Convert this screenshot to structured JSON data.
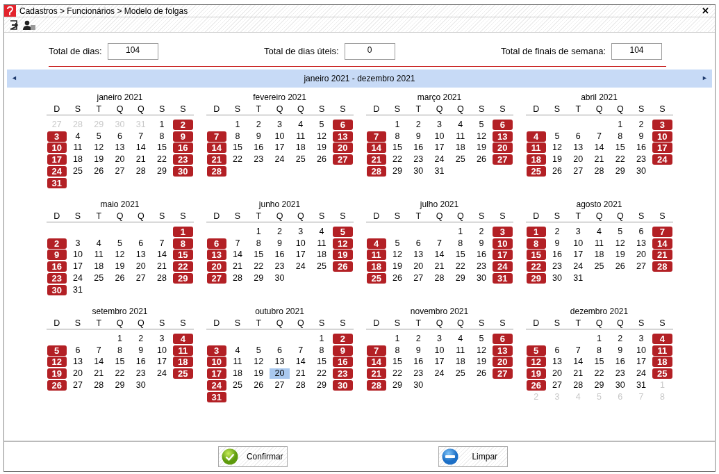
{
  "window": {
    "title": "Cadastros > Funcionários > Modelo de folgas",
    "close": "✕"
  },
  "totals": [
    {
      "label": "Total de dias:",
      "value": "104"
    },
    {
      "label": "Total de dias úteis:",
      "value": "0"
    },
    {
      "label": "Total de finais de semana:",
      "value": "104"
    }
  ],
  "range": {
    "prev": "◄",
    "title": "janeiro 2021 - dezembro 2021",
    "next": "►"
  },
  "months": [
    {
      "title": "janeiro 2021",
      "weekdays": [
        "D",
        "S",
        "T",
        "Q",
        "Q",
        "S",
        "S"
      ],
      "weeks": [
        [
          {
            "day": "27",
            "kind": "other"
          },
          {
            "day": "28",
            "kind": "other"
          },
          {
            "day": "29",
            "kind": "other"
          },
          {
            "day": "30",
            "kind": "other"
          },
          {
            "day": "31",
            "kind": "other"
          },
          {
            "day": "1",
            "kind": "day"
          },
          {
            "day": "2",
            "kind": "off"
          }
        ],
        [
          {
            "day": "3",
            "kind": "off"
          },
          {
            "day": "4",
            "kind": "day"
          },
          {
            "day": "5",
            "kind": "day"
          },
          {
            "day": "6",
            "kind": "day"
          },
          {
            "day": "7",
            "kind": "day"
          },
          {
            "day": "8",
            "kind": "day"
          },
          {
            "day": "9",
            "kind": "off"
          }
        ],
        [
          {
            "day": "10",
            "kind": "off"
          },
          {
            "day": "11",
            "kind": "day"
          },
          {
            "day": "12",
            "kind": "day"
          },
          {
            "day": "13",
            "kind": "day"
          },
          {
            "day": "14",
            "kind": "day"
          },
          {
            "day": "15",
            "kind": "day"
          },
          {
            "day": "16",
            "kind": "off"
          }
        ],
        [
          {
            "day": "17",
            "kind": "off"
          },
          {
            "day": "18",
            "kind": "day"
          },
          {
            "day": "19",
            "kind": "day"
          },
          {
            "day": "20",
            "kind": "day"
          },
          {
            "day": "21",
            "kind": "day"
          },
          {
            "day": "22",
            "kind": "day"
          },
          {
            "day": "23",
            "kind": "off"
          }
        ],
        [
          {
            "day": "24",
            "kind": "off"
          },
          {
            "day": "25",
            "kind": "day"
          },
          {
            "day": "26",
            "kind": "day"
          },
          {
            "day": "27",
            "kind": "day"
          },
          {
            "day": "28",
            "kind": "day"
          },
          {
            "day": "29",
            "kind": "day"
          },
          {
            "day": "30",
            "kind": "off"
          }
        ],
        [
          {
            "day": "31",
            "kind": "off"
          }
        ]
      ]
    },
    {
      "title": "fevereiro 2021",
      "weekdays": [
        "D",
        "S",
        "T",
        "Q",
        "Q",
        "S",
        "S"
      ],
      "weeks": [
        [
          {
            "kind": "blank"
          },
          {
            "day": "1",
            "kind": "day"
          },
          {
            "day": "2",
            "kind": "day"
          },
          {
            "day": "3",
            "kind": "day"
          },
          {
            "day": "4",
            "kind": "day"
          },
          {
            "day": "5",
            "kind": "day"
          },
          {
            "day": "6",
            "kind": "off"
          }
        ],
        [
          {
            "day": "7",
            "kind": "off"
          },
          {
            "day": "8",
            "kind": "day"
          },
          {
            "day": "9",
            "kind": "day"
          },
          {
            "day": "10",
            "kind": "day"
          },
          {
            "day": "11",
            "kind": "day"
          },
          {
            "day": "12",
            "kind": "day"
          },
          {
            "day": "13",
            "kind": "off"
          }
        ],
        [
          {
            "day": "14",
            "kind": "off"
          },
          {
            "day": "15",
            "kind": "day"
          },
          {
            "day": "16",
            "kind": "day"
          },
          {
            "day": "17",
            "kind": "day"
          },
          {
            "day": "18",
            "kind": "day"
          },
          {
            "day": "19",
            "kind": "day"
          },
          {
            "day": "20",
            "kind": "off"
          }
        ],
        [
          {
            "day": "21",
            "kind": "off"
          },
          {
            "day": "22",
            "kind": "day"
          },
          {
            "day": "23",
            "kind": "day"
          },
          {
            "day": "24",
            "kind": "day"
          },
          {
            "day": "25",
            "kind": "day"
          },
          {
            "day": "26",
            "kind": "day"
          },
          {
            "day": "27",
            "kind": "off"
          }
        ],
        [
          {
            "day": "28",
            "kind": "off"
          }
        ]
      ]
    },
    {
      "title": "março 2021",
      "weekdays": [
        "D",
        "S",
        "T",
        "Q",
        "Q",
        "S",
        "S"
      ],
      "weeks": [
        [
          {
            "kind": "blank"
          },
          {
            "day": "1",
            "kind": "day"
          },
          {
            "day": "2",
            "kind": "day"
          },
          {
            "day": "3",
            "kind": "day"
          },
          {
            "day": "4",
            "kind": "day"
          },
          {
            "day": "5",
            "kind": "day"
          },
          {
            "day": "6",
            "kind": "off"
          }
        ],
        [
          {
            "day": "7",
            "kind": "off"
          },
          {
            "day": "8",
            "kind": "day"
          },
          {
            "day": "9",
            "kind": "day"
          },
          {
            "day": "10",
            "kind": "day"
          },
          {
            "day": "11",
            "kind": "day"
          },
          {
            "day": "12",
            "kind": "day"
          },
          {
            "day": "13",
            "kind": "off"
          }
        ],
        [
          {
            "day": "14",
            "kind": "off"
          },
          {
            "day": "15",
            "kind": "day"
          },
          {
            "day": "16",
            "kind": "day"
          },
          {
            "day": "17",
            "kind": "day"
          },
          {
            "day": "18",
            "kind": "day"
          },
          {
            "day": "19",
            "kind": "day"
          },
          {
            "day": "20",
            "kind": "off"
          }
        ],
        [
          {
            "day": "21",
            "kind": "off"
          },
          {
            "day": "22",
            "kind": "day"
          },
          {
            "day": "23",
            "kind": "day"
          },
          {
            "day": "24",
            "kind": "day"
          },
          {
            "day": "25",
            "kind": "day"
          },
          {
            "day": "26",
            "kind": "day"
          },
          {
            "day": "27",
            "kind": "off"
          }
        ],
        [
          {
            "day": "28",
            "kind": "off"
          },
          {
            "day": "29",
            "kind": "day"
          },
          {
            "day": "30",
            "kind": "day"
          },
          {
            "day": "31",
            "kind": "day"
          }
        ]
      ]
    },
    {
      "title": "abril 2021",
      "weekdays": [
        "D",
        "S",
        "T",
        "Q",
        "Q",
        "S",
        "S"
      ],
      "weeks": [
        [
          {
            "kind": "blank"
          },
          {
            "kind": "blank"
          },
          {
            "kind": "blank"
          },
          {
            "kind": "blank"
          },
          {
            "day": "1",
            "kind": "day"
          },
          {
            "day": "2",
            "kind": "day"
          },
          {
            "day": "3",
            "kind": "off"
          }
        ],
        [
          {
            "day": "4",
            "kind": "off"
          },
          {
            "day": "5",
            "kind": "day"
          },
          {
            "day": "6",
            "kind": "day"
          },
          {
            "day": "7",
            "kind": "day"
          },
          {
            "day": "8",
            "kind": "day"
          },
          {
            "day": "9",
            "kind": "day"
          },
          {
            "day": "10",
            "kind": "off"
          }
        ],
        [
          {
            "day": "11",
            "kind": "off"
          },
          {
            "day": "12",
            "kind": "day"
          },
          {
            "day": "13",
            "kind": "day"
          },
          {
            "day": "14",
            "kind": "day"
          },
          {
            "day": "15",
            "kind": "day"
          },
          {
            "day": "16",
            "kind": "day"
          },
          {
            "day": "17",
            "kind": "off"
          }
        ],
        [
          {
            "day": "18",
            "kind": "off"
          },
          {
            "day": "19",
            "kind": "day"
          },
          {
            "day": "20",
            "kind": "day"
          },
          {
            "day": "21",
            "kind": "day"
          },
          {
            "day": "22",
            "kind": "day"
          },
          {
            "day": "23",
            "kind": "day"
          },
          {
            "day": "24",
            "kind": "off"
          }
        ],
        [
          {
            "day": "25",
            "kind": "off"
          },
          {
            "day": "26",
            "kind": "day"
          },
          {
            "day": "27",
            "kind": "day"
          },
          {
            "day": "28",
            "kind": "day"
          },
          {
            "day": "29",
            "kind": "day"
          },
          {
            "day": "30",
            "kind": "day"
          }
        ]
      ]
    },
    {
      "title": "maio 2021",
      "weekdays": [
        "D",
        "S",
        "T",
        "Q",
        "Q",
        "S",
        "S"
      ],
      "weeks": [
        [
          {
            "kind": "blank"
          },
          {
            "kind": "blank"
          },
          {
            "kind": "blank"
          },
          {
            "kind": "blank"
          },
          {
            "kind": "blank"
          },
          {
            "kind": "blank"
          },
          {
            "day": "1",
            "kind": "off"
          }
        ],
        [
          {
            "day": "2",
            "kind": "off"
          },
          {
            "day": "3",
            "kind": "day"
          },
          {
            "day": "4",
            "kind": "day"
          },
          {
            "day": "5",
            "kind": "day"
          },
          {
            "day": "6",
            "kind": "day"
          },
          {
            "day": "7",
            "kind": "day"
          },
          {
            "day": "8",
            "kind": "off"
          }
        ],
        [
          {
            "day": "9",
            "kind": "off"
          },
          {
            "day": "10",
            "kind": "day"
          },
          {
            "day": "11",
            "kind": "day"
          },
          {
            "day": "12",
            "kind": "day"
          },
          {
            "day": "13",
            "kind": "day"
          },
          {
            "day": "14",
            "kind": "day"
          },
          {
            "day": "15",
            "kind": "off"
          }
        ],
        [
          {
            "day": "16",
            "kind": "off"
          },
          {
            "day": "17",
            "kind": "day"
          },
          {
            "day": "18",
            "kind": "day"
          },
          {
            "day": "19",
            "kind": "day"
          },
          {
            "day": "20",
            "kind": "day"
          },
          {
            "day": "21",
            "kind": "day"
          },
          {
            "day": "22",
            "kind": "off"
          }
        ],
        [
          {
            "day": "23",
            "kind": "off"
          },
          {
            "day": "24",
            "kind": "day"
          },
          {
            "day": "25",
            "kind": "day"
          },
          {
            "day": "26",
            "kind": "day"
          },
          {
            "day": "27",
            "kind": "day"
          },
          {
            "day": "28",
            "kind": "day"
          },
          {
            "day": "29",
            "kind": "off"
          }
        ],
        [
          {
            "day": "30",
            "kind": "off"
          },
          {
            "day": "31",
            "kind": "day"
          }
        ]
      ]
    },
    {
      "title": "junho 2021",
      "weekdays": [
        "D",
        "S",
        "T",
        "Q",
        "Q",
        "S",
        "S"
      ],
      "weeks": [
        [
          {
            "kind": "blank"
          },
          {
            "kind": "blank"
          },
          {
            "day": "1",
            "kind": "day"
          },
          {
            "day": "2",
            "kind": "day"
          },
          {
            "day": "3",
            "kind": "day"
          },
          {
            "day": "4",
            "kind": "day"
          },
          {
            "day": "5",
            "kind": "off"
          }
        ],
        [
          {
            "day": "6",
            "kind": "off"
          },
          {
            "day": "7",
            "kind": "day"
          },
          {
            "day": "8",
            "kind": "day"
          },
          {
            "day": "9",
            "kind": "day"
          },
          {
            "day": "10",
            "kind": "day"
          },
          {
            "day": "11",
            "kind": "day"
          },
          {
            "day": "12",
            "kind": "off"
          }
        ],
        [
          {
            "day": "13",
            "kind": "off"
          },
          {
            "day": "14",
            "kind": "day"
          },
          {
            "day": "15",
            "kind": "day"
          },
          {
            "day": "16",
            "kind": "day"
          },
          {
            "day": "17",
            "kind": "day"
          },
          {
            "day": "18",
            "kind": "day"
          },
          {
            "day": "19",
            "kind": "off"
          }
        ],
        [
          {
            "day": "20",
            "kind": "off"
          },
          {
            "day": "21",
            "kind": "day"
          },
          {
            "day": "22",
            "kind": "day"
          },
          {
            "day": "23",
            "kind": "day"
          },
          {
            "day": "24",
            "kind": "day"
          },
          {
            "day": "25",
            "kind": "day"
          },
          {
            "day": "26",
            "kind": "off"
          }
        ],
        [
          {
            "day": "27",
            "kind": "off"
          },
          {
            "day": "28",
            "kind": "day"
          },
          {
            "day": "29",
            "kind": "day"
          },
          {
            "day": "30",
            "kind": "day"
          }
        ]
      ]
    },
    {
      "title": "julho 2021",
      "weekdays": [
        "D",
        "S",
        "T",
        "Q",
        "Q",
        "S",
        "S"
      ],
      "weeks": [
        [
          {
            "kind": "blank"
          },
          {
            "kind": "blank"
          },
          {
            "kind": "blank"
          },
          {
            "kind": "blank"
          },
          {
            "day": "1",
            "kind": "day"
          },
          {
            "day": "2",
            "kind": "day"
          },
          {
            "day": "3",
            "kind": "off"
          }
        ],
        [
          {
            "day": "4",
            "kind": "off"
          },
          {
            "day": "5",
            "kind": "day"
          },
          {
            "day": "6",
            "kind": "day"
          },
          {
            "day": "7",
            "kind": "day"
          },
          {
            "day": "8",
            "kind": "day"
          },
          {
            "day": "9",
            "kind": "day"
          },
          {
            "day": "10",
            "kind": "off"
          }
        ],
        [
          {
            "day": "11",
            "kind": "off"
          },
          {
            "day": "12",
            "kind": "day"
          },
          {
            "day": "13",
            "kind": "day"
          },
          {
            "day": "14",
            "kind": "day"
          },
          {
            "day": "15",
            "kind": "day"
          },
          {
            "day": "16",
            "kind": "day"
          },
          {
            "day": "17",
            "kind": "off"
          }
        ],
        [
          {
            "day": "18",
            "kind": "off"
          },
          {
            "day": "19",
            "kind": "day"
          },
          {
            "day": "20",
            "kind": "day"
          },
          {
            "day": "21",
            "kind": "day"
          },
          {
            "day": "22",
            "kind": "day"
          },
          {
            "day": "23",
            "kind": "day"
          },
          {
            "day": "24",
            "kind": "off"
          }
        ],
        [
          {
            "day": "25",
            "kind": "off"
          },
          {
            "day": "26",
            "kind": "day"
          },
          {
            "day": "27",
            "kind": "day"
          },
          {
            "day": "28",
            "kind": "day"
          },
          {
            "day": "29",
            "kind": "day"
          },
          {
            "day": "30",
            "kind": "day"
          },
          {
            "day": "31",
            "kind": "off"
          }
        ]
      ]
    },
    {
      "title": "agosto 2021",
      "weekdays": [
        "D",
        "S",
        "T",
        "Q",
        "Q",
        "S",
        "S"
      ],
      "weeks": [
        [
          {
            "day": "1",
            "kind": "off"
          },
          {
            "day": "2",
            "kind": "day"
          },
          {
            "day": "3",
            "kind": "day"
          },
          {
            "day": "4",
            "kind": "day"
          },
          {
            "day": "5",
            "kind": "day"
          },
          {
            "day": "6",
            "kind": "day"
          },
          {
            "day": "7",
            "kind": "off"
          }
        ],
        [
          {
            "day": "8",
            "kind": "off"
          },
          {
            "day": "9",
            "kind": "day"
          },
          {
            "day": "10",
            "kind": "day"
          },
          {
            "day": "11",
            "kind": "day"
          },
          {
            "day": "12",
            "kind": "day"
          },
          {
            "day": "13",
            "kind": "day"
          },
          {
            "day": "14",
            "kind": "off"
          }
        ],
        [
          {
            "day": "15",
            "kind": "off"
          },
          {
            "day": "16",
            "kind": "day"
          },
          {
            "day": "17",
            "kind": "day"
          },
          {
            "day": "18",
            "kind": "day"
          },
          {
            "day": "19",
            "kind": "day"
          },
          {
            "day": "20",
            "kind": "day"
          },
          {
            "day": "21",
            "kind": "off"
          }
        ],
        [
          {
            "day": "22",
            "kind": "off"
          },
          {
            "day": "23",
            "kind": "day"
          },
          {
            "day": "24",
            "kind": "day"
          },
          {
            "day": "25",
            "kind": "day"
          },
          {
            "day": "26",
            "kind": "day"
          },
          {
            "day": "27",
            "kind": "day"
          },
          {
            "day": "28",
            "kind": "off"
          }
        ],
        [
          {
            "day": "29",
            "kind": "off"
          },
          {
            "day": "30",
            "kind": "day"
          },
          {
            "day": "31",
            "kind": "day"
          }
        ]
      ]
    },
    {
      "title": "setembro 2021",
      "weekdays": [
        "D",
        "S",
        "T",
        "Q",
        "Q",
        "S",
        "S"
      ],
      "weeks": [
        [
          {
            "kind": "blank"
          },
          {
            "kind": "blank"
          },
          {
            "kind": "blank"
          },
          {
            "day": "1",
            "kind": "day"
          },
          {
            "day": "2",
            "kind": "day"
          },
          {
            "day": "3",
            "kind": "day"
          },
          {
            "day": "4",
            "kind": "off"
          }
        ],
        [
          {
            "day": "5",
            "kind": "off"
          },
          {
            "day": "6",
            "kind": "day"
          },
          {
            "day": "7",
            "kind": "day"
          },
          {
            "day": "8",
            "kind": "day"
          },
          {
            "day": "9",
            "kind": "day"
          },
          {
            "day": "10",
            "kind": "day"
          },
          {
            "day": "11",
            "kind": "off"
          }
        ],
        [
          {
            "day": "12",
            "kind": "off"
          },
          {
            "day": "13",
            "kind": "day"
          },
          {
            "day": "14",
            "kind": "day"
          },
          {
            "day": "15",
            "kind": "day"
          },
          {
            "day": "16",
            "kind": "day"
          },
          {
            "day": "17",
            "kind": "day"
          },
          {
            "day": "18",
            "kind": "off"
          }
        ],
        [
          {
            "day": "19",
            "kind": "off"
          },
          {
            "day": "20",
            "kind": "day"
          },
          {
            "day": "21",
            "kind": "day"
          },
          {
            "day": "22",
            "kind": "day"
          },
          {
            "day": "23",
            "kind": "day"
          },
          {
            "day": "24",
            "kind": "day"
          },
          {
            "day": "25",
            "kind": "off"
          }
        ],
        [
          {
            "day": "26",
            "kind": "off"
          },
          {
            "day": "27",
            "kind": "day"
          },
          {
            "day": "28",
            "kind": "day"
          },
          {
            "day": "29",
            "kind": "day"
          },
          {
            "day": "30",
            "kind": "day"
          }
        ]
      ]
    },
    {
      "title": "outubro 2021",
      "weekdays": [
        "D",
        "S",
        "T",
        "Q",
        "Q",
        "S",
        "S"
      ],
      "weeks": [
        [
          {
            "kind": "blank"
          },
          {
            "kind": "blank"
          },
          {
            "kind": "blank"
          },
          {
            "kind": "blank"
          },
          {
            "kind": "blank"
          },
          {
            "day": "1",
            "kind": "day"
          },
          {
            "day": "2",
            "kind": "off"
          }
        ],
        [
          {
            "day": "3",
            "kind": "off"
          },
          {
            "day": "4",
            "kind": "day"
          },
          {
            "day": "5",
            "kind": "day"
          },
          {
            "day": "6",
            "kind": "day"
          },
          {
            "day": "7",
            "kind": "day"
          },
          {
            "day": "8",
            "kind": "day"
          },
          {
            "day": "9",
            "kind": "off"
          }
        ],
        [
          {
            "day": "10",
            "kind": "off"
          },
          {
            "day": "11",
            "kind": "day"
          },
          {
            "day": "12",
            "kind": "day"
          },
          {
            "day": "13",
            "kind": "day"
          },
          {
            "day": "14",
            "kind": "day"
          },
          {
            "day": "15",
            "kind": "day"
          },
          {
            "day": "16",
            "kind": "off"
          }
        ],
        [
          {
            "day": "17",
            "kind": "off"
          },
          {
            "day": "18",
            "kind": "day"
          },
          {
            "day": "19",
            "kind": "day"
          },
          {
            "day": "20",
            "kind": "today"
          },
          {
            "day": "21",
            "kind": "day"
          },
          {
            "day": "22",
            "kind": "day"
          },
          {
            "day": "23",
            "kind": "off"
          }
        ],
        [
          {
            "day": "24",
            "kind": "off"
          },
          {
            "day": "25",
            "kind": "day"
          },
          {
            "day": "26",
            "kind": "day"
          },
          {
            "day": "27",
            "kind": "day"
          },
          {
            "day": "28",
            "kind": "day"
          },
          {
            "day": "29",
            "kind": "day"
          },
          {
            "day": "30",
            "kind": "off"
          }
        ],
        [
          {
            "day": "31",
            "kind": "off"
          }
        ]
      ]
    },
    {
      "title": "novembro 2021",
      "weekdays": [
        "D",
        "S",
        "T",
        "Q",
        "Q",
        "S",
        "S"
      ],
      "weeks": [
        [
          {
            "kind": "blank"
          },
          {
            "day": "1",
            "kind": "day"
          },
          {
            "day": "2",
            "kind": "day"
          },
          {
            "day": "3",
            "kind": "day"
          },
          {
            "day": "4",
            "kind": "day"
          },
          {
            "day": "5",
            "kind": "day"
          },
          {
            "day": "6",
            "kind": "off"
          }
        ],
        [
          {
            "day": "7",
            "kind": "off"
          },
          {
            "day": "8",
            "kind": "day"
          },
          {
            "day": "9",
            "kind": "day"
          },
          {
            "day": "10",
            "kind": "day"
          },
          {
            "day": "11",
            "kind": "day"
          },
          {
            "day": "12",
            "kind": "day"
          },
          {
            "day": "13",
            "kind": "off"
          }
        ],
        [
          {
            "day": "14",
            "kind": "off"
          },
          {
            "day": "15",
            "kind": "day"
          },
          {
            "day": "16",
            "kind": "day"
          },
          {
            "day": "17",
            "kind": "day"
          },
          {
            "day": "18",
            "kind": "day"
          },
          {
            "day": "19",
            "kind": "day"
          },
          {
            "day": "20",
            "kind": "off"
          }
        ],
        [
          {
            "day": "21",
            "kind": "off"
          },
          {
            "day": "22",
            "kind": "day"
          },
          {
            "day": "23",
            "kind": "day"
          },
          {
            "day": "24",
            "kind": "day"
          },
          {
            "day": "25",
            "kind": "day"
          },
          {
            "day": "26",
            "kind": "day"
          },
          {
            "day": "27",
            "kind": "off"
          }
        ],
        [
          {
            "day": "28",
            "kind": "off"
          },
          {
            "day": "29",
            "kind": "day"
          },
          {
            "day": "30",
            "kind": "day"
          }
        ]
      ]
    },
    {
      "title": "dezembro 2021",
      "weekdays": [
        "D",
        "S",
        "T",
        "Q",
        "Q",
        "S",
        "S"
      ],
      "weeks": [
        [
          {
            "kind": "blank"
          },
          {
            "kind": "blank"
          },
          {
            "kind": "blank"
          },
          {
            "day": "1",
            "kind": "day"
          },
          {
            "day": "2",
            "kind": "day"
          },
          {
            "day": "3",
            "kind": "day"
          },
          {
            "day": "4",
            "kind": "off"
          }
        ],
        [
          {
            "day": "5",
            "kind": "off"
          },
          {
            "day": "6",
            "kind": "day"
          },
          {
            "day": "7",
            "kind": "day"
          },
          {
            "day": "8",
            "kind": "day"
          },
          {
            "day": "9",
            "kind": "day"
          },
          {
            "day": "10",
            "kind": "day"
          },
          {
            "day": "11",
            "kind": "off"
          }
        ],
        [
          {
            "day": "12",
            "kind": "off"
          },
          {
            "day": "13",
            "kind": "day"
          },
          {
            "day": "14",
            "kind": "day"
          },
          {
            "day": "15",
            "kind": "day"
          },
          {
            "day": "16",
            "kind": "day"
          },
          {
            "day": "17",
            "kind": "day"
          },
          {
            "day": "18",
            "kind": "off"
          }
        ],
        [
          {
            "day": "19",
            "kind": "off"
          },
          {
            "day": "20",
            "kind": "day"
          },
          {
            "day": "21",
            "kind": "day"
          },
          {
            "day": "22",
            "kind": "day"
          },
          {
            "day": "23",
            "kind": "day"
          },
          {
            "day": "24",
            "kind": "day"
          },
          {
            "day": "25",
            "kind": "off"
          }
        ],
        [
          {
            "day": "26",
            "kind": "off"
          },
          {
            "day": "27",
            "kind": "day"
          },
          {
            "day": "28",
            "kind": "day"
          },
          {
            "day": "29",
            "kind": "day"
          },
          {
            "day": "30",
            "kind": "day"
          },
          {
            "day": "31",
            "kind": "day"
          },
          {
            "day": "1",
            "kind": "other"
          }
        ],
        [
          {
            "day": "2",
            "kind": "other"
          },
          {
            "day": "3",
            "kind": "other"
          },
          {
            "day": "4",
            "kind": "other"
          },
          {
            "day": "5",
            "kind": "other"
          },
          {
            "day": "6",
            "kind": "other"
          },
          {
            "day": "7",
            "kind": "other"
          },
          {
            "day": "8",
            "kind": "other"
          }
        ]
      ]
    }
  ],
  "buttons": [
    {
      "label": "Confirmar",
      "kind": "confirm"
    },
    {
      "label": "Limpar",
      "kind": "clear"
    }
  ]
}
